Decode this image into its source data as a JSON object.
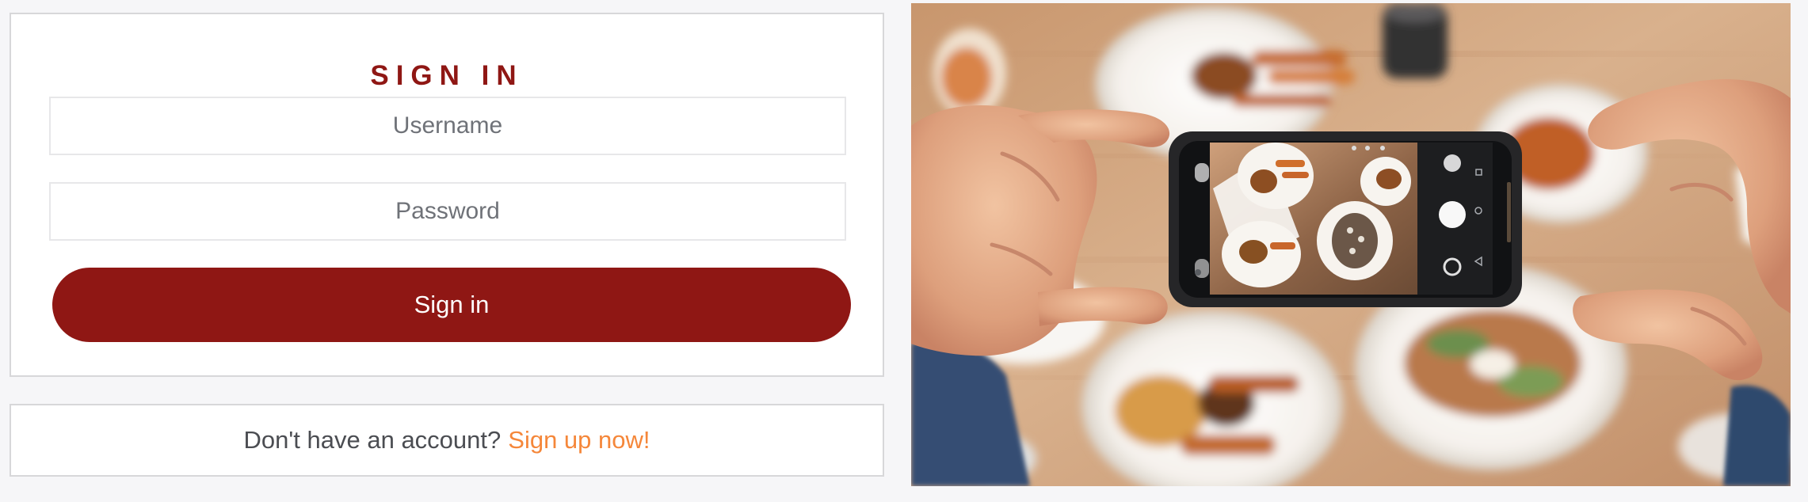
{
  "signin": {
    "title": "SIGN IN",
    "username_placeholder": "Username",
    "password_placeholder": "Password",
    "button_label": "Sign in"
  },
  "signup": {
    "prompt": "Don't have an account?",
    "link_label": "Sign up now!"
  },
  "colors": {
    "brand_red": "#8f1714",
    "accent_orange": "#f5873a",
    "page_background": "#f6f6f8",
    "card_background": "#ffffff"
  }
}
